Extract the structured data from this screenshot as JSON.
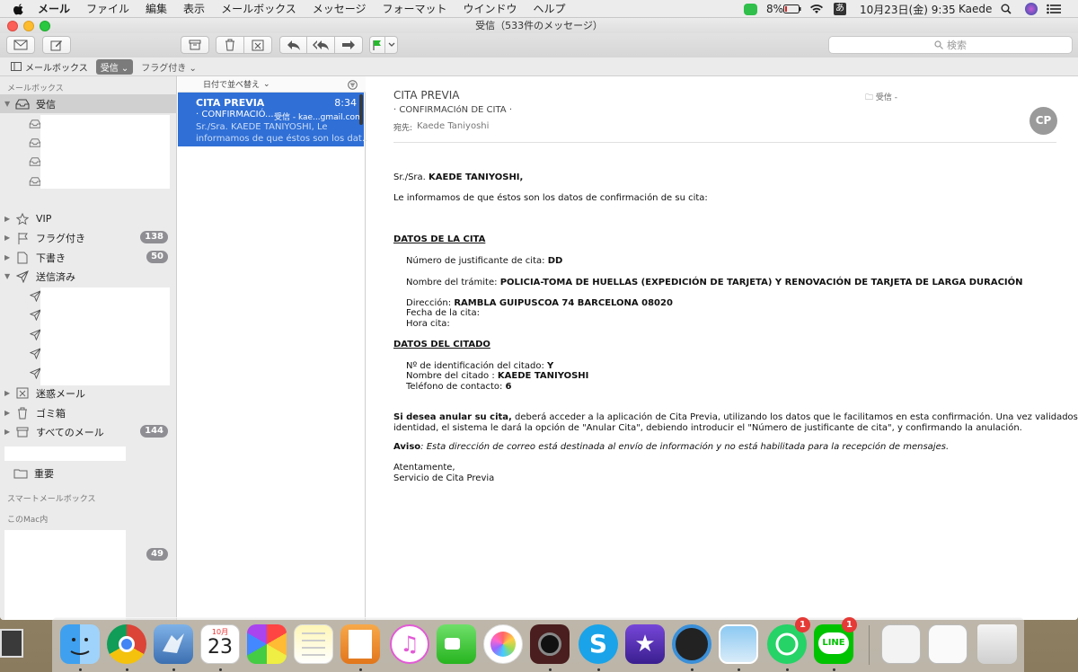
{
  "menubar": {
    "app": "メール",
    "items": [
      "ファイル",
      "編集",
      "表示",
      "メールボックス",
      "メッセージ",
      "フォーマット",
      "ウインドウ",
      "ヘルプ"
    ],
    "battery": "8%",
    "ime": "あ",
    "clock": "10月23日(金)  9:35",
    "user": "Kaede"
  },
  "window": {
    "title": "受信（533件のメッセージ）",
    "search_placeholder": "検索"
  },
  "favbar": {
    "mailboxes": "メールボックス",
    "inbox": "受信",
    "flagged": "フラグ付き"
  },
  "sidebar": {
    "section_mailboxes": "メールボックス",
    "inbox": "受信",
    "vip": "VIP",
    "flagged": "フラグ付き",
    "flagged_count": "138",
    "drafts": "下書き",
    "drafts_count": "50",
    "sent": "送信済み",
    "junk": "迷惑メール",
    "trash": "ゴミ箱",
    "all": "すべてのメール",
    "all_count": "144",
    "important": "重要",
    "section_smart": "スマートメールボックス",
    "section_mac": "このMac内",
    "mac_count": "49"
  },
  "list": {
    "sort_label": "日付で並べ替え",
    "sender": "CITA PREVIA",
    "time": "8:34",
    "subject": "· CONFIRMACIÓ...",
    "mailbox": "受信 - kae...gmail.com",
    "preview_line1": "Sr./Sra. KAEDE TANIYOSHI, Le",
    "preview_line2": "informamos de que éstos son los dat..."
  },
  "message": {
    "from": "CITA PREVIA",
    "subject": "· CONFIRMACIóN DE CITA ·",
    "folder": "受信 -",
    "to_label": "宛先:",
    "to": "Kaede Taniyoshi",
    "avatar": "CP",
    "greeting_prefix": "Sr./Sra.",
    "greeting_name": "KAEDE TANIYOSHI,",
    "intro": "Le informamos de que éstos son los datos de confirmación de su cita:",
    "h_cita": "DATOS DE LA CITA",
    "num_label": "Número de justificante de cita:",
    "num_value": "DD",
    "tramite_label": "Nombre del trámite:",
    "tramite_value": "POLICIA-TOMA DE HUELLAS (EXPEDICIÓN DE TARJETA) Y RENOVACIÓN DE TARJETA DE LARGA DURACIÓN",
    "dir_label": "Dirección:",
    "dir_value": "RAMBLA GUIPUSCOA 74 BARCELONA 08020",
    "fecha_label": "Fecha de la cita:",
    "hora_label": "Hora cita:",
    "h_citado": "DATOS DEL CITADO",
    "id_label": "Nº de identificación del citado:",
    "id_value": "Y",
    "nombre_label": "Nombre del citado :",
    "nombre_value": "KAEDE TANIYOSHI",
    "tel_label": "Teléfono de contacto:",
    "tel_value": "6",
    "anular_bold": "Si desea anular su cita,",
    "anular_rest1": " deberá acceder a la aplicación de Cita Previa, utilizando los datos que le facilitamos en esta confirmación. Una vez validados sus datos de",
    "anular_rest2": "identidad, el sistema le dará la opción de \"Anular Cita\", debiendo introducir el \"Número de justificante de cita\", y confirmando la anulación.",
    "aviso_label": "Aviso",
    "aviso_text": ": Esta dirección de correo está destinada al envío de información y no está habilitada para la recepción de mensajes.",
    "closing1": "Atentamente,",
    "closing2": "Servicio de Cita Previa"
  },
  "dock": {
    "calendar_month": "10月",
    "calendar_day": "23",
    "whatsapp_badge": "1",
    "line_badge": "1",
    "line_label": "LINE"
  }
}
